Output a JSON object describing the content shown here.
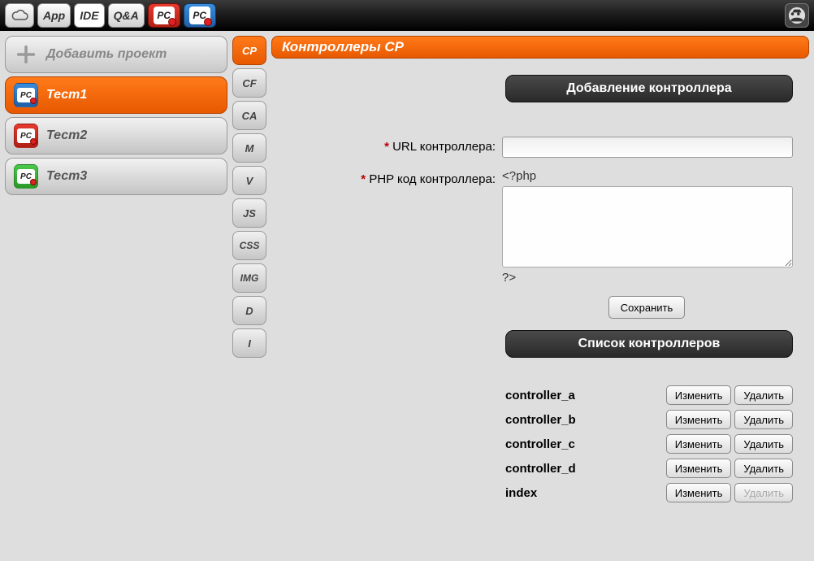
{
  "topbar": {
    "buttons": [
      {
        "label": "",
        "name": "cloud-button",
        "icon": "cloud"
      },
      {
        "label": "App",
        "name": "app-button"
      },
      {
        "label": "IDE",
        "name": "ide-button",
        "active": true
      },
      {
        "label": "Q&A",
        "name": "qa-button"
      },
      {
        "label": "PC",
        "name": "pc-red-button",
        "style": "red-badge"
      },
      {
        "label": "PC",
        "name": "pc-blue-button",
        "style": "blue-badge"
      }
    ]
  },
  "sidebar": {
    "add_project_label": "Добавить проект",
    "projects": [
      {
        "label": "Тест1",
        "chip": "blue",
        "selected": true
      },
      {
        "label": "Тест2",
        "chip": "red",
        "selected": false
      },
      {
        "label": "Тест3",
        "chip": "green",
        "selected": false
      }
    ]
  },
  "tabs": [
    {
      "label": "CP",
      "selected": true
    },
    {
      "label": "CF"
    },
    {
      "label": "CA"
    },
    {
      "label": "M"
    },
    {
      "label": "V"
    },
    {
      "label": "JS"
    },
    {
      "label": "CSS"
    },
    {
      "label": "IMG"
    },
    {
      "label": "D"
    },
    {
      "label": "I"
    }
  ],
  "main": {
    "title": "Контроллеры CP",
    "add_section_title": "Добавление контроллера",
    "field_url_label": "URL контроллера:",
    "field_code_label": "PHP код контроллера:",
    "required_marker": "*",
    "code_prefix": "<?php",
    "code_suffix": "?>",
    "url_value": "",
    "code_value": "",
    "save_button": "Сохранить",
    "list_section_title": "Список контроллеров",
    "edit_button": "Изменить",
    "delete_button": "Удалить",
    "controllers": [
      {
        "name": "controller_a",
        "deletable": true
      },
      {
        "name": "controller_b",
        "deletable": true
      },
      {
        "name": "controller_c",
        "deletable": true
      },
      {
        "name": "controller_d",
        "deletable": true
      },
      {
        "name": "index",
        "deletable": false
      }
    ]
  }
}
